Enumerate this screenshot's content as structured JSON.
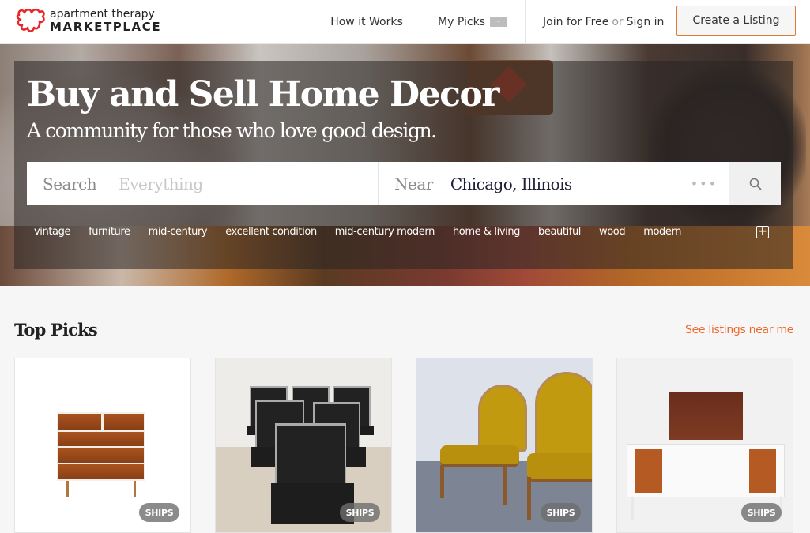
{
  "header": {
    "logo": {
      "line1": "apartment therapy",
      "line2": "MARKETPLACE",
      "icon": "apartment-therapy-logo-icon",
      "brand_color": "#e8262a"
    },
    "nav": {
      "how_it_works": "How it Works",
      "my_picks": "My Picks",
      "my_picks_badge": "-",
      "join": "Join for Free",
      "or": "or",
      "sign_in": "Sign in",
      "create_listing": "Create a Listing"
    },
    "accent_color": "#e07b39"
  },
  "hero": {
    "title": "Buy and Sell Home Decor",
    "subtitle": "A community for those who love good design.",
    "search": {
      "label": "Search",
      "placeholder": "Everything",
      "value": ""
    },
    "near": {
      "label": "Near",
      "value": "Chicago, Illinois",
      "more_icon": "ellipsis-icon"
    },
    "search_button_icon": "search-icon",
    "tags": [
      "vintage",
      "furniture",
      "mid-century",
      "excellent condition",
      "mid-century modern",
      "home & living",
      "beautiful",
      "wood",
      "modern"
    ],
    "add_tag_icon": "plus-square-icon"
  },
  "top_picks": {
    "title": "Top Picks",
    "near_link": "See listings near me",
    "link_color": "#f0672a",
    "cards": [
      {
        "image": "mid-century dresser",
        "badge": "SHIPS"
      },
      {
        "image": "black leather cantilever chairs",
        "badge": "SHIPS"
      },
      {
        "image": "yellow velvet armchairs",
        "badge": "SHIPS"
      },
      {
        "image": "white stereo console",
        "badge": "SHIPS"
      }
    ]
  }
}
